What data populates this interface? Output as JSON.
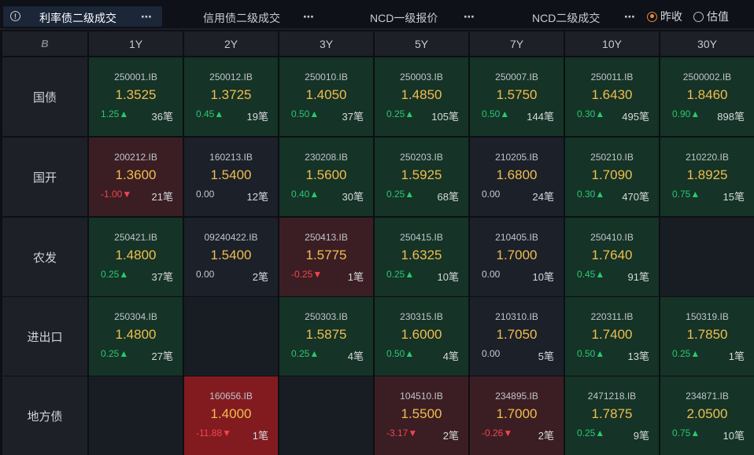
{
  "tabs": [
    {
      "label": "利率债二级成交",
      "active": true,
      "has_info_icon": true
    },
    {
      "label": "信用债二级成交",
      "active": false
    },
    {
      "label": "NCD一级报价",
      "active": false
    },
    {
      "label": "NCD二级成交",
      "active": false
    }
  ],
  "more_icon": "⋯",
  "info_icon": "!",
  "radio_options": [
    {
      "label": "昨收",
      "checked": true
    },
    {
      "label": "估值",
      "checked": false
    }
  ],
  "corner_icon": "B",
  "columns": [
    "1Y",
    "2Y",
    "3Y",
    "5Y",
    "7Y",
    "10Y",
    "30Y"
  ],
  "rows": [
    {
      "label": "国债",
      "cells": [
        {
          "code": "250001.IB",
          "yield": "1.3525",
          "change": "1.25▲",
          "dir": "up",
          "count": "36笔",
          "tone": "up"
        },
        {
          "code": "250012.IB",
          "yield": "1.3725",
          "change": "0.45▲",
          "dir": "up",
          "count": "19笔",
          "tone": "up"
        },
        {
          "code": "250010.IB",
          "yield": "1.4050",
          "change": "0.50▲",
          "dir": "up",
          "count": "37笔",
          "tone": "up"
        },
        {
          "code": "250003.IB",
          "yield": "1.4850",
          "change": "0.25▲",
          "dir": "up",
          "count": "105笔",
          "tone": "up"
        },
        {
          "code": "250007.IB",
          "yield": "1.5750",
          "change": "0.50▲",
          "dir": "up",
          "count": "144笔",
          "tone": "up"
        },
        {
          "code": "250011.IB",
          "yield": "1.6430",
          "change": "0.30▲",
          "dir": "up",
          "count": "495笔",
          "tone": "up"
        },
        {
          "code": "2500002.IB",
          "yield": "1.8460",
          "change": "0.90▲",
          "dir": "up",
          "count": "898笔",
          "tone": "up"
        }
      ]
    },
    {
      "label": "国开",
      "cells": [
        {
          "code": "200212.IB",
          "yield": "1.3600",
          "change": "-1.00▼",
          "dir": "down",
          "count": "21笔",
          "tone": "down"
        },
        {
          "code": "160213.IB",
          "yield": "1.5400",
          "change": "0.00",
          "dir": "flat",
          "count": "12笔",
          "tone": "flat"
        },
        {
          "code": "230208.IB",
          "yield": "1.5600",
          "change": "0.40▲",
          "dir": "up",
          "count": "30笔",
          "tone": "up"
        },
        {
          "code": "250203.IB",
          "yield": "1.5925",
          "change": "0.25▲",
          "dir": "up",
          "count": "68笔",
          "tone": "up"
        },
        {
          "code": "210205.IB",
          "yield": "1.6800",
          "change": "0.00",
          "dir": "flat",
          "count": "24笔",
          "tone": "flat"
        },
        {
          "code": "250210.IB",
          "yield": "1.7090",
          "change": "0.30▲",
          "dir": "up",
          "count": "470笔",
          "tone": "up"
        },
        {
          "code": "210220.IB",
          "yield": "1.8925",
          "change": "0.75▲",
          "dir": "up",
          "count": "15笔",
          "tone": "up"
        }
      ]
    },
    {
      "label": "农发",
      "cells": [
        {
          "code": "250421.IB",
          "yield": "1.4800",
          "change": "0.25▲",
          "dir": "up",
          "count": "37笔",
          "tone": "up"
        },
        {
          "code": "09240422.IB",
          "yield": "1.5400",
          "change": "0.00",
          "dir": "flat",
          "count": "2笔",
          "tone": "flat"
        },
        {
          "code": "250413.IB",
          "yield": "1.5775",
          "change": "-0.25▼",
          "dir": "down",
          "count": "1笔",
          "tone": "down"
        },
        {
          "code": "250415.IB",
          "yield": "1.6325",
          "change": "0.25▲",
          "dir": "up",
          "count": "10笔",
          "tone": "up"
        },
        {
          "code": "210405.IB",
          "yield": "1.7000",
          "change": "0.00",
          "dir": "flat",
          "count": "10笔",
          "tone": "flat"
        },
        {
          "code": "250410.IB",
          "yield": "1.7640",
          "change": "0.45▲",
          "dir": "up",
          "count": "91笔",
          "tone": "up"
        },
        null
      ]
    },
    {
      "label": "进出口",
      "cells": [
        {
          "code": "250304.IB",
          "yield": "1.4800",
          "change": "0.25▲",
          "dir": "up",
          "count": "27笔",
          "tone": "up"
        },
        null,
        {
          "code": "250303.IB",
          "yield": "1.5875",
          "change": "0.25▲",
          "dir": "up",
          "count": "4笔",
          "tone": "up"
        },
        {
          "code": "230315.IB",
          "yield": "1.6000",
          "change": "0.50▲",
          "dir": "up",
          "count": "4笔",
          "tone": "up"
        },
        {
          "code": "210310.IB",
          "yield": "1.7050",
          "change": "0.00",
          "dir": "flat",
          "count": "5笔",
          "tone": "flat"
        },
        {
          "code": "220311.IB",
          "yield": "1.7400",
          "change": "0.50▲",
          "dir": "up",
          "count": "13笔",
          "tone": "up"
        },
        {
          "code": "150319.IB",
          "yield": "1.7850",
          "change": "0.25▲",
          "dir": "up",
          "count": "1笔",
          "tone": "up"
        }
      ]
    },
    {
      "label": "地方债",
      "cells": [
        null,
        {
          "code": "160656.IB",
          "yield": "1.4000",
          "change": "-11.88▼",
          "dir": "down",
          "count": "1笔",
          "tone": "hot"
        },
        null,
        {
          "code": "104510.IB",
          "yield": "1.5500",
          "change": "-3.17▼",
          "dir": "down",
          "count": "2笔",
          "tone": "down"
        },
        {
          "code": "234895.IB",
          "yield": "1.7000",
          "change": "-0.26▼",
          "dir": "down",
          "count": "2笔",
          "tone": "down"
        },
        {
          "code": "2471218.IB",
          "yield": "1.7875",
          "change": "0.25▲",
          "dir": "up",
          "count": "9笔",
          "tone": "up"
        },
        {
          "code": "234871.IB",
          "yield": "2.0500",
          "change": "0.75▲",
          "dir": "up",
          "count": "10笔",
          "tone": "up"
        }
      ]
    }
  ]
}
